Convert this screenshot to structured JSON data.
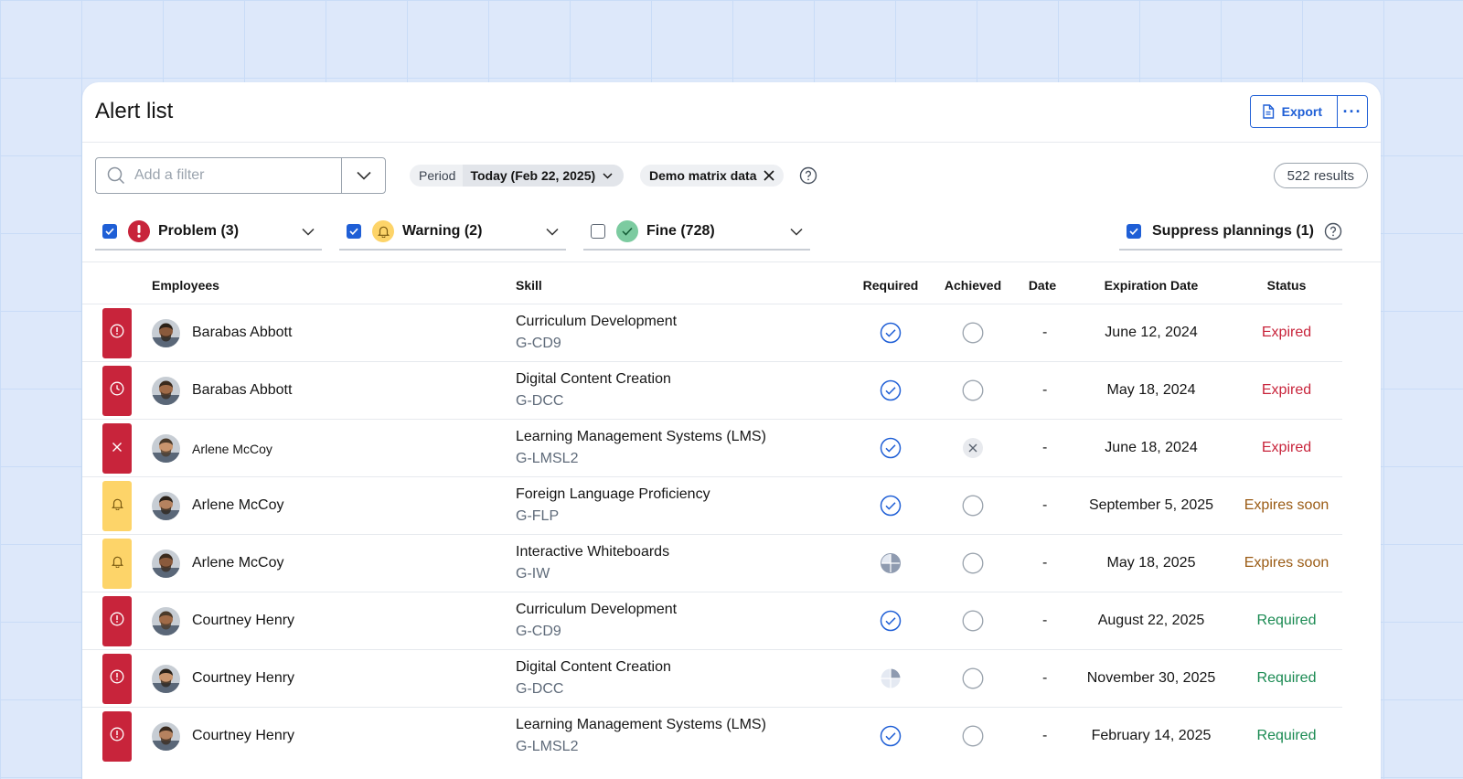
{
  "header": {
    "title": "Alert list",
    "export_label": "Export",
    "more_label": "···"
  },
  "filter": {
    "placeholder": "Add  a filter"
  },
  "period": {
    "label": "Period",
    "value": "Today (Feb 22, 2025)"
  },
  "demo_chip": {
    "label": "Demo matrix data"
  },
  "results": {
    "label": "522 results"
  },
  "categories": [
    {
      "label": "Problem (3)",
      "checked": true,
      "icon": "exclamation-icon",
      "color": "#c8243b"
    },
    {
      "label": "Warning (2)",
      "checked": true,
      "icon": "bell-icon",
      "color": "#fdd469"
    },
    {
      "label": "Fine (728)",
      "checked": false,
      "icon": "check-icon",
      "color": "#7ccba0"
    }
  ],
  "suppress": {
    "label": "Suppress plannings (1)",
    "checked": true
  },
  "columns": {
    "employees": "Employees",
    "skill": "Skill",
    "required": "Required",
    "achieved": "Achieved",
    "date": "Date",
    "expiration": "Expiration Date",
    "status": "Status"
  },
  "colors": {
    "accent": "#1f5fd6",
    "problem": "#c8243b",
    "warning": "#fdd469",
    "expired": "#c8243b",
    "soon": "#9a5b14",
    "required": "#1a8a52"
  },
  "rows": [
    {
      "severity": "problem",
      "icon": "exclamation-icon",
      "employee": "Barabas Abbott",
      "skill": "Curriculum Development",
      "code": "G-CD9",
      "required": "check",
      "achieved": "empty",
      "date": "-",
      "expiration": "June 12, 2024",
      "status": "Expired",
      "status_kind": "expired"
    },
    {
      "severity": "problem",
      "icon": "clock-icon",
      "employee": "Barabas Abbott",
      "skill": "Digital Content Creation",
      "code": "G-DCC",
      "required": "check",
      "achieved": "empty",
      "date": "-",
      "expiration": "May 18, 2024",
      "status": "Expired",
      "status_kind": "expired"
    },
    {
      "severity": "problem",
      "icon": "close-icon",
      "employee": "Arlene McCoy",
      "skill": "Learning Management Systems (LMS)",
      "code": "G-LMSL2",
      "required": "check",
      "achieved": "x",
      "date": "-",
      "expiration": "June 18, 2024",
      "status": "Expired",
      "status_kind": "expired"
    },
    {
      "severity": "warning",
      "icon": "bell-icon",
      "employee": "Arlene McCoy",
      "skill": "Foreign Language Proficiency",
      "code": "G-FLP",
      "required": "check",
      "achieved": "empty",
      "date": "-",
      "expiration": "September 5, 2025",
      "status": "Expires soon",
      "status_kind": "soon"
    },
    {
      "severity": "warning",
      "icon": "bell-icon",
      "employee": "Arlene McCoy",
      "skill": "Interactive Whiteboards",
      "code": "G-IW",
      "required": "partial-3",
      "achieved": "empty",
      "date": "-",
      "expiration": "May 18, 2025",
      "status": "Expires soon",
      "status_kind": "soon"
    },
    {
      "severity": "problem",
      "icon": "exclamation-icon",
      "employee": "Courtney Henry",
      "skill": "Curriculum Development",
      "code": "G-CD9",
      "required": "check",
      "achieved": "empty",
      "date": "-",
      "expiration": "August 22, 2025",
      "status": "Required",
      "status_kind": "required"
    },
    {
      "severity": "problem",
      "icon": "exclamation-icon",
      "employee": "Courtney Henry",
      "skill": "Digital Content Creation",
      "code": "G-DCC",
      "required": "partial-1",
      "achieved": "empty",
      "date": "-",
      "expiration": "November 30, 2025",
      "status": "Required",
      "status_kind": "required"
    },
    {
      "severity": "problem",
      "icon": "exclamation-icon",
      "employee": "Courtney Henry",
      "skill": "Learning Management Systems (LMS)",
      "code": "G-LMSL2",
      "required": "check",
      "achieved": "empty",
      "date": "-",
      "expiration": "February 14, 2025",
      "status": "Required",
      "status_kind": "required"
    }
  ]
}
